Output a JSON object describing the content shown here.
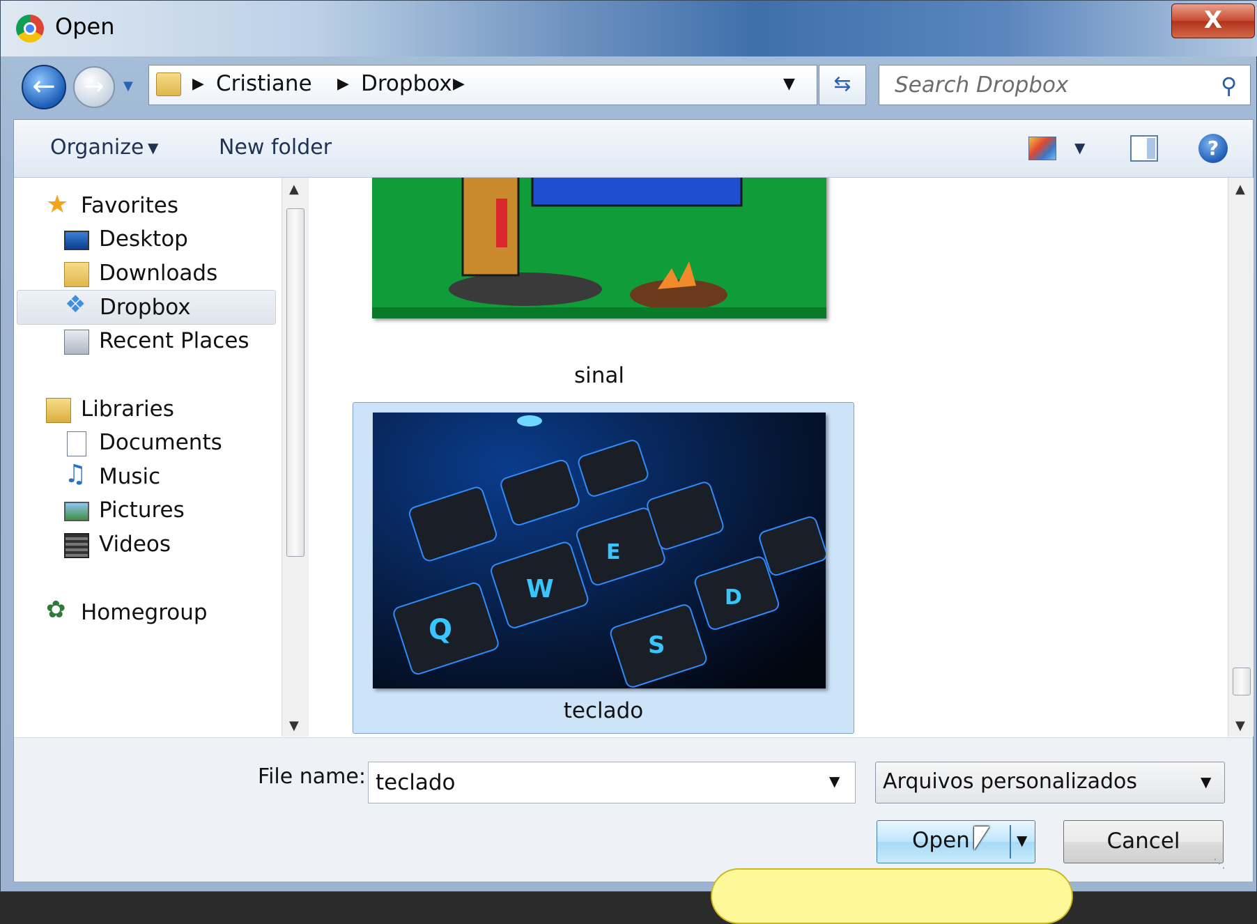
{
  "window": {
    "title": "Open",
    "close_label": "X",
    "colors": {
      "titlebar": "#3f6fab",
      "selection": "#cde3f8",
      "accent": "#2a62b6"
    }
  },
  "address_bar": {
    "breadcrumbs": [
      "Cristiane",
      "Dropbox"
    ],
    "search_placeholder": "Search Dropbox"
  },
  "toolbar": {
    "organize_label": "Organize",
    "new_folder_label": "New folder",
    "icons": [
      "views-icon",
      "preview-pane-icon",
      "help-icon"
    ]
  },
  "nav": {
    "groups": [
      {
        "label": "Favorites",
        "icon": "star-icon",
        "items": [
          {
            "label": "Desktop",
            "icon": "desktop-icon"
          },
          {
            "label": "Downloads",
            "icon": "downloads-icon"
          },
          {
            "label": "Dropbox",
            "icon": "dropbox-icon",
            "selected": true
          },
          {
            "label": "Recent Places",
            "icon": "recent-places-icon"
          }
        ]
      },
      {
        "label": "Libraries",
        "icon": "libraries-icon",
        "items": [
          {
            "label": "Documents",
            "icon": "documents-icon"
          },
          {
            "label": "Music",
            "icon": "music-icon"
          },
          {
            "label": "Pictures",
            "icon": "pictures-icon"
          },
          {
            "label": "Videos",
            "icon": "videos-icon"
          }
        ]
      },
      {
        "label": "Homegroup",
        "icon": "homegroup-icon",
        "items": []
      }
    ]
  },
  "files": [
    {
      "name": "sinal",
      "selected": false
    },
    {
      "name": "teclado",
      "selected": true
    }
  ],
  "footer": {
    "file_name_label": "File name:",
    "file_name_value": "teclado",
    "file_type": "Arquivos personalizados",
    "open_label": "Open",
    "cancel_label": "Cancel"
  }
}
